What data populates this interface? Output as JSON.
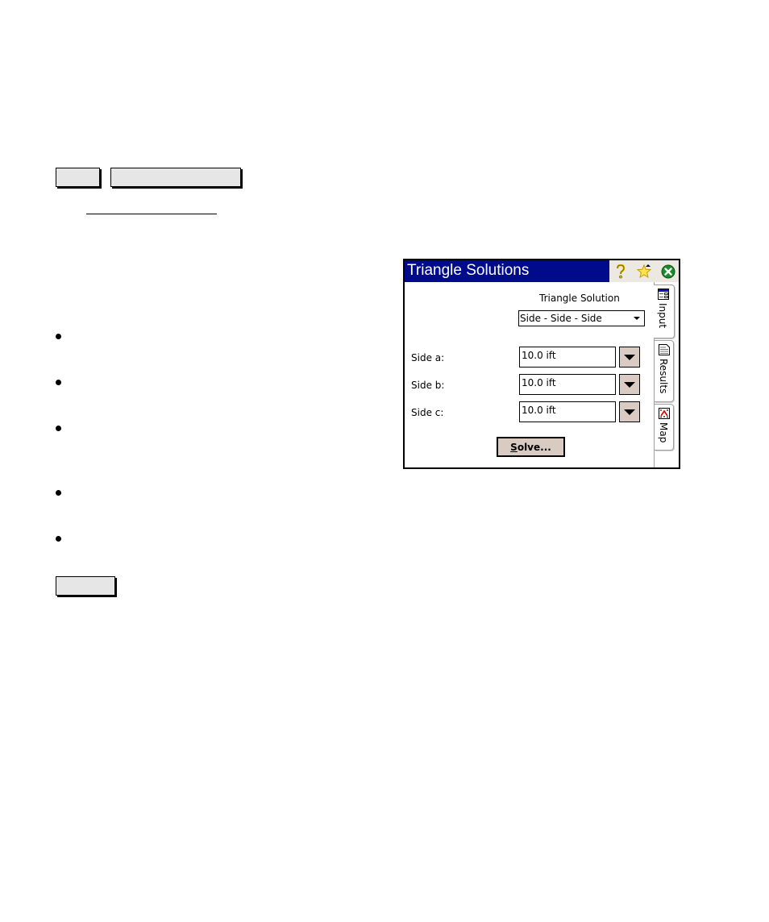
{
  "document": {
    "placeholder_boxes": 3,
    "bullets": 5
  },
  "dialog": {
    "title": "Triangle Solutions",
    "title_icons": [
      "help-icon",
      "favorites-star-icon",
      "close-icon"
    ],
    "colors": {
      "titlebar": "#000b8c",
      "button_face": "#d9cbc1",
      "close_green": "#1a8a2a"
    },
    "solution_label": "Triangle Solution",
    "solution_select": {
      "selected": "Side - Side - Side"
    },
    "sides": [
      {
        "label": "Side a:",
        "value": "10.0 ift"
      },
      {
        "label": "Side b:",
        "value": "10.0 ift"
      },
      {
        "label": "Side c:",
        "value": "10.0 ift"
      }
    ],
    "solve_button": {
      "mnemonic": "S",
      "rest": "olve..."
    },
    "tabs": [
      {
        "label": "Input",
        "icon": "input-form-icon",
        "active": true
      },
      {
        "label": "Results",
        "icon": "results-sheet-icon",
        "active": false
      },
      {
        "label": "Map",
        "icon": "map-icon",
        "active": false
      }
    ]
  }
}
